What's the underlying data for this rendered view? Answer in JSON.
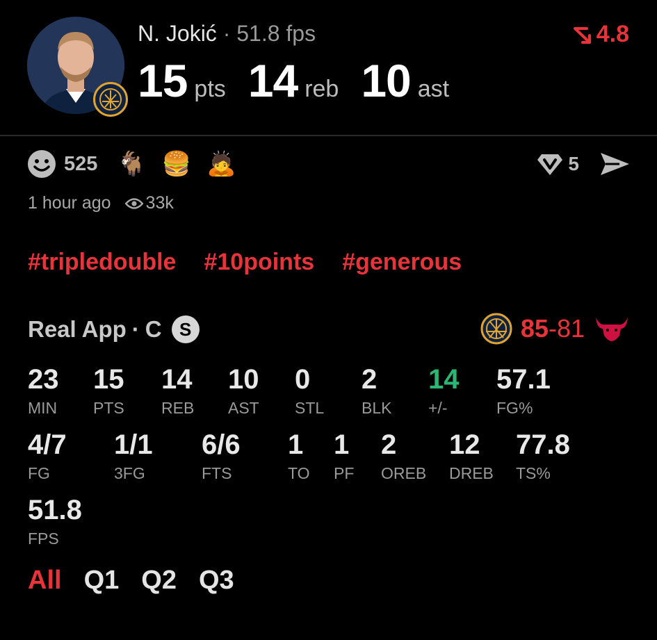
{
  "player": {
    "name": "N. Jokić",
    "separator": "·",
    "fps": "51.8 fps",
    "rating": "4.8",
    "headline": [
      {
        "value": "15",
        "unit": "pts"
      },
      {
        "value": "14",
        "unit": "reb"
      },
      {
        "value": "10",
        "unit": "ast"
      }
    ]
  },
  "reactions": {
    "count": "525",
    "emojis": [
      "🐐",
      "🍔",
      "🙇"
    ],
    "comments": "5",
    "posted": "1 hour ago",
    "views": "33k"
  },
  "hashtags": [
    "#tripledouble",
    "#10points",
    "#generous"
  ],
  "game": {
    "app": "Real App",
    "position": "C",
    "badge": "S",
    "score_home": "85",
    "score_dash": "-",
    "score_away": "81"
  },
  "stats": [
    {
      "value": "23",
      "label": "MIN"
    },
    {
      "value": "15",
      "label": "PTS"
    },
    {
      "value": "14",
      "label": "REB"
    },
    {
      "value": "10",
      "label": "AST"
    },
    {
      "value": "0",
      "label": "STL"
    },
    {
      "value": "2",
      "label": "BLK"
    },
    {
      "value": "14",
      "label": "+/-"
    },
    {
      "value": "57.1",
      "label": "FG%"
    },
    {
      "value": "4/7",
      "label": "FG"
    },
    {
      "value": "1/1",
      "label": "3FG"
    },
    {
      "value": "6/6",
      "label": "FTS"
    },
    {
      "value": "1",
      "label": "TO"
    },
    {
      "value": "1",
      "label": "PF"
    },
    {
      "value": "2",
      "label": "OREB"
    },
    {
      "value": "12",
      "label": "DREB"
    },
    {
      "value": "77.8",
      "label": "TS%"
    },
    {
      "value": "51.8",
      "label": "FPS"
    }
  ],
  "quarters": {
    "active": "All",
    "tabs": [
      "All",
      "Q1",
      "Q2",
      "Q3"
    ]
  },
  "colors": {
    "accent": "#e8333b",
    "positive": "#2bb673",
    "background": "#000000"
  },
  "icons": {
    "rating": "trend-down-icon",
    "reaction": "smiley-icon",
    "comments": "comment-icon",
    "share": "send-icon",
    "views": "eye-icon",
    "team_home": "nuggets-logo-icon",
    "team_away": "bulls-logo-icon"
  }
}
